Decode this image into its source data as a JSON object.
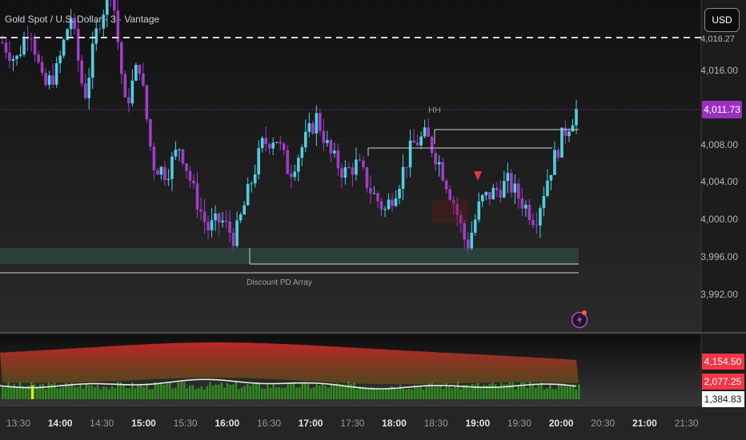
{
  "header": {
    "title": "Gold Spot / U.S. Dollar · 3 · Vantage",
    "currency_button": "USD"
  },
  "price_axis": {
    "cut_label": "4,016.27",
    "ticks": [
      "4,016.00",
      "4,012.00",
      "4,008.00",
      "4,004.00",
      "4,000.00",
      "3,996.00",
      "3,992.00"
    ],
    "current_price": "4,011.73",
    "current_price_color": "#9b30c0"
  },
  "indicator_axis": {
    "labels": [
      "4,154.50",
      "2,077.25",
      "1,384.83"
    ],
    "label_colors": [
      "#f23645",
      "#f23645",
      "#ffffff"
    ]
  },
  "annotations": {
    "hh_label": "HH",
    "zone_label": "Discount PD Array"
  },
  "time_axis": {
    "labels": [
      "13:30",
      "14:00",
      "14:30",
      "15:00",
      "15:30",
      "16:00",
      "16:30",
      "17:00",
      "17:30",
      "18:00",
      "18:30",
      "19:00",
      "19:30",
      "20:00",
      "20:30",
      "21:00",
      "21:30"
    ],
    "bold_labels": [
      "14:00",
      "15:00",
      "16:00",
      "17:00",
      "18:00",
      "19:00",
      "20:00",
      "21:00"
    ]
  },
  "colors": {
    "up_candle": "#4dd0e1",
    "down_candle": "#a23cc8",
    "volume_bar": "#2e8b1e",
    "indicator_band": "#b71c1c",
    "alert_icon": "#b040e0"
  },
  "icons": {
    "alert": "lightning-alert-icon"
  },
  "chart_data": {
    "type": "candlestick",
    "series": [
      {
        "name": "",
        "close_path": [
          4019.0,
          4017.0,
          4021.0,
          4014.0,
          4016.0,
          4022.0,
          4013.0,
          4021.0,
          4025.0,
          4012.0,
          4017.0,
          4006.0,
          4005.0,
          4008.0,
          4003.0,
          3999.0,
          4000.0,
          3998.0,
          4003.0,
          4008.0,
          4009.0,
          4005.0,
          4008.0,
          4011.0,
          4007.0,
          4005.0,
          4006.0,
          4003.0,
          4001.0,
          4004.0,
          4008.0,
          4009.0,
          4006.0,
          4002.0,
          3997.0,
          4002.0,
          4003.0,
          4004.0,
          4002.0,
          4000.0,
          4005.0,
          4009.0,
          4011.73
        ]
      }
    ]
  }
}
